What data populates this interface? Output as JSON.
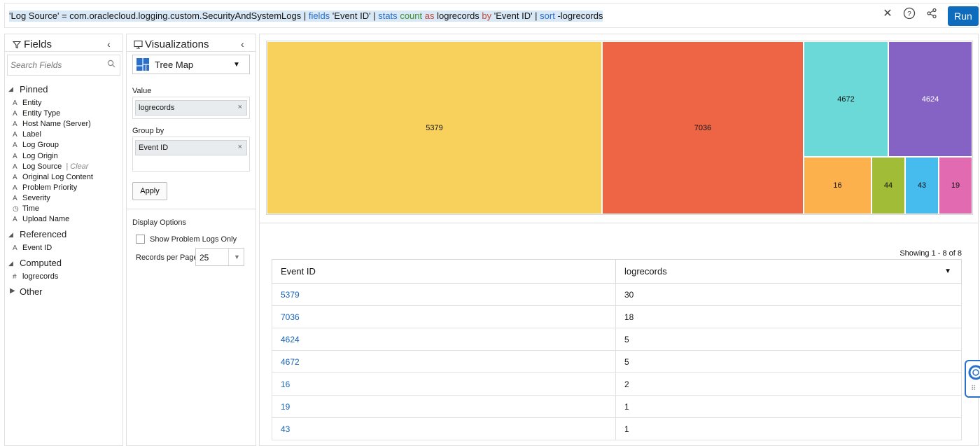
{
  "query": {
    "parts": [
      {
        "text": "'Log Source' = com.oraclecloud.logging.custom.SecurityAndSystemLogs | ",
        "cls": ""
      },
      {
        "text": "fields",
        "cls": "kw-blue"
      },
      {
        "text": " 'Event ID' | ",
        "cls": ""
      },
      {
        "text": "stats",
        "cls": "kw-blue"
      },
      {
        "text": " ",
        "cls": ""
      },
      {
        "text": "count",
        "cls": "kw-green"
      },
      {
        "text": " ",
        "cls": ""
      },
      {
        "text": "as",
        "cls": "kw-red"
      },
      {
        "text": " logrecords ",
        "cls": ""
      },
      {
        "text": "by",
        "cls": "kw-red"
      },
      {
        "text": " 'Event ID' | ",
        "cls": ""
      },
      {
        "text": "sort",
        "cls": "kw-blue"
      },
      {
        "text": " -logrecords",
        "cls": ""
      }
    ],
    "run_label": "Run"
  },
  "fields_panel": {
    "title": "Fields",
    "search_placeholder": "Search Fields",
    "groups": {
      "pinned": "Pinned",
      "referenced": "Referenced",
      "computed": "Computed",
      "other": "Other"
    },
    "pinned": [
      {
        "type": "A",
        "name": "Entity"
      },
      {
        "type": "A",
        "name": "Entity Type"
      },
      {
        "type": "A",
        "name": "Host Name (Server)"
      },
      {
        "type": "A",
        "name": "Label"
      },
      {
        "type": "A",
        "name": "Log Group"
      },
      {
        "type": "A",
        "name": "Log Origin"
      },
      {
        "type": "A",
        "name": "Log Source",
        "extra": "| Clear"
      },
      {
        "type": "A",
        "name": "Original Log Content"
      },
      {
        "type": "A",
        "name": "Problem Priority"
      },
      {
        "type": "A",
        "name": "Severity"
      },
      {
        "type": "◷",
        "name": "Time"
      },
      {
        "type": "A",
        "name": "Upload Name"
      }
    ],
    "referenced": [
      {
        "type": "A",
        "name": "Event ID"
      }
    ],
    "computed": [
      {
        "type": "#",
        "name": "logrecords"
      }
    ]
  },
  "viz_panel": {
    "title": "Visualizations",
    "selected": "Tree Map",
    "value_label": "Value",
    "value_chip": "logrecords",
    "group_label": "Group by",
    "group_chip": "Event ID",
    "apply_label": "Apply",
    "display_options": "Display Options",
    "problem_logs_label": "Show Problem Logs Only",
    "records_label": "Records per Page",
    "records_value": "25"
  },
  "treemap": {
    "tiles": [
      {
        "label": "5379",
        "color": "#f8d15c"
      },
      {
        "label": "7036",
        "color": "#ee6545"
      },
      {
        "label": "4672",
        "color": "#6ad9d8"
      },
      {
        "label": "4624",
        "color": "#8463c4"
      },
      {
        "label": "16",
        "color": "#fdb14c"
      },
      {
        "label": "44",
        "color": "#a1bd38"
      },
      {
        "label": "43",
        "color": "#45bbee"
      },
      {
        "label": "19",
        "color": "#e26ab0"
      }
    ]
  },
  "table": {
    "showing": "Showing 1 - 8 of 8",
    "columns": [
      "Event ID",
      "logrecords"
    ],
    "rows": [
      {
        "event_id": "5379",
        "logrecords": "30"
      },
      {
        "event_id": "7036",
        "logrecords": "18"
      },
      {
        "event_id": "4624",
        "logrecords": "5"
      },
      {
        "event_id": "4672",
        "logrecords": "5"
      },
      {
        "event_id": "16",
        "logrecords": "2"
      },
      {
        "event_id": "19",
        "logrecords": "1"
      },
      {
        "event_id": "43",
        "logrecords": "1"
      }
    ]
  }
}
